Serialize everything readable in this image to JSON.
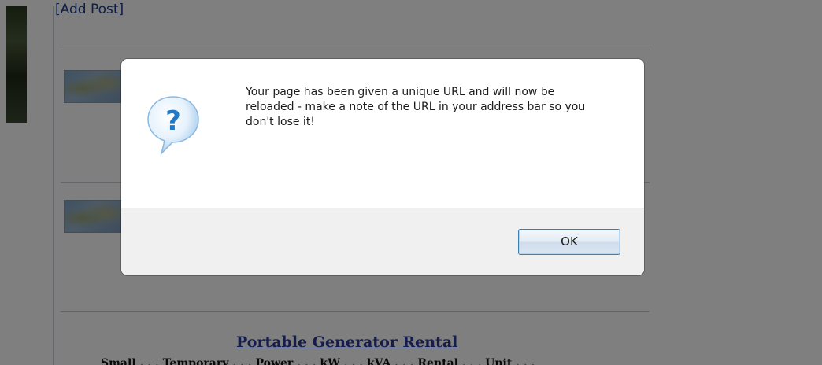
{
  "page": {
    "add_post_link": "[Add Post]",
    "listing_title": "Portable Generator Rental",
    "cut_text": "Small . . . Temporary . . . Power . . . kW . . . kVA . . . Rental . . . Unit . . ."
  },
  "dialog": {
    "icon": "question-icon",
    "message": "Your page has been given a unique URL and will now be\nreloaded - make a note of the URL in your address bar so you\ndon't lose it!",
    "ok_label": "OK"
  },
  "colors": {
    "overlay": "#000000",
    "link": "#1a3a8a",
    "button_border": "#3c7fb1",
    "icon_blue": "#1f78c8"
  }
}
